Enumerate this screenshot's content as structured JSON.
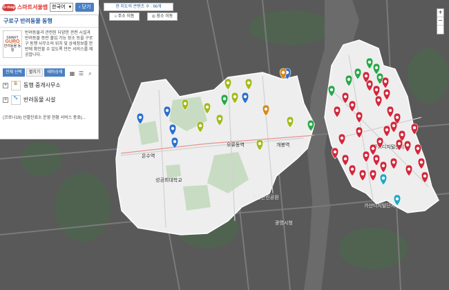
{
  "app": {
    "logo_badge": "G-map",
    "logo_text": "스마트서울맵",
    "language": "한국어",
    "close_label": "닫기"
  },
  "panel": {
    "title": "구로구 반려동물 동행",
    "intro_logo_lines": [
      "SMART",
      "GURO",
      "반려동물 동행"
    ],
    "intro_text": "반려동물과 관련된 다양한 관련 시설과 반려동물 동반 출입 가능 장소 등을 구로구 동행 사무소의 위치 및 상세정보를 한 번에 확인할 수 있도록 만든 서비스를 제공합니다.",
    "tabs": [
      "전체 선택",
      "펼치기",
      "테마상세"
    ],
    "categories": [
      {
        "label": "동행 중개사무소",
        "icon": "office-icon"
      },
      {
        "label": "반려동물 시설",
        "icon": "pet-facility-icon"
      }
    ],
    "notice": "(코로나19) 선별진료소 운영 현황 서비스 종료(..."
  },
  "map_controls": {
    "count_text": "현 지도의 콘텐츠 수 : 66개",
    "address_move": "주소 이동",
    "place_move": "장소 이동",
    "zoom_in": "+",
    "zoom_out": "−"
  },
  "map_labels": {
    "places": [
      "온수역",
      "오류동역",
      "구로디지털단지",
      "광명시청",
      "성공회대학교",
      "개봉역",
      "현충근린공원",
      "가산디지털단지"
    ]
  },
  "colors": {
    "red_marker": "#d2283c",
    "green_marker": "#2aa84a",
    "yellowgreen_marker": "#a3b91d",
    "blue_marker": "#2b6fd0",
    "orange_marker": "#d48a1e",
    "cyan_marker": "#22a8c8"
  }
}
